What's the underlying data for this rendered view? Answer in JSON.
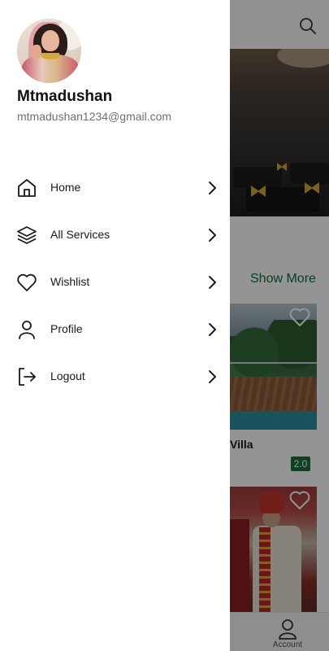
{
  "drawer": {
    "user": {
      "name": "Mtmadushan",
      "email": "mtmadushan1234@gmail.com"
    },
    "menu": [
      {
        "label": "Home",
        "icon": "home-icon"
      },
      {
        "label": "All Services",
        "icon": "layers-icon"
      },
      {
        "label": "Wishlist",
        "icon": "heart-icon"
      },
      {
        "label": "Profile",
        "icon": "person-icon"
      },
      {
        "label": "Logout",
        "icon": "logout-icon"
      }
    ]
  },
  "background": {
    "show_more": "Show More",
    "card_title": "Villa",
    "card_rating": "2.0",
    "bottom_nav": {
      "account_label": "Account"
    }
  },
  "colors": {
    "accent_green": "#0e6b3d",
    "rating_badge": "#1a6e3a",
    "scrim": "rgba(0,0,0,0.42)"
  }
}
